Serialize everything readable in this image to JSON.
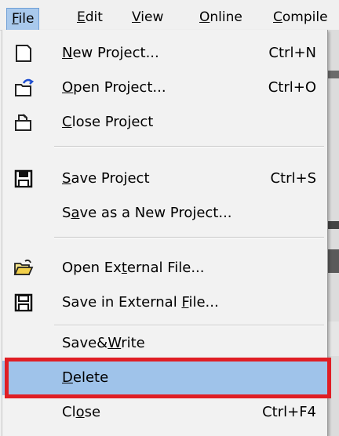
{
  "menubar": {
    "items": [
      {
        "label": "File",
        "u": "F"
      },
      {
        "label": "Edit",
        "u": "E"
      },
      {
        "label": "View",
        "u": "V"
      },
      {
        "label": "Online",
        "u": "O"
      },
      {
        "label": "Compile",
        "u": "C"
      }
    ]
  },
  "menu": {
    "items": [
      {
        "pre": "",
        "u": "N",
        "post": "ew Project...",
        "shortcut": "Ctrl+N",
        "icon": "new-project-icon"
      },
      {
        "pre": "",
        "u": "O",
        "post": "pen Project...",
        "shortcut": "Ctrl+O",
        "icon": "open-project-icon"
      },
      {
        "pre": "",
        "u": "C",
        "post": "lose Project",
        "shortcut": "",
        "icon": "close-project-icon"
      },
      {
        "pre": "",
        "u": "S",
        "post": "ave Project",
        "shortcut": "Ctrl+S",
        "icon": "save-project-icon"
      },
      {
        "pre": "S",
        "u": "a",
        "post": "ve as a New Project...",
        "shortcut": "",
        "icon": ""
      },
      {
        "pre": "Open Ex",
        "u": "t",
        "post": "ernal File...",
        "shortcut": "",
        "icon": "open-external-file-icon"
      },
      {
        "pre": "Save in External ",
        "u": "F",
        "post": "ile...",
        "shortcut": "",
        "icon": "save-external-file-icon"
      },
      {
        "pre": "Save&",
        "u": "W",
        "post": "rite",
        "shortcut": "",
        "icon": ""
      },
      {
        "pre": "",
        "u": "D",
        "post": "elete",
        "shortcut": "",
        "icon": ""
      },
      {
        "pre": "Cl",
        "u": "o",
        "post": "se",
        "shortcut": "Ctrl+F4",
        "icon": ""
      }
    ]
  },
  "colors": {
    "highlight": "#9fc3ea",
    "annotation_frame": "#e01e24",
    "menu_bg": "#f2f2f2",
    "active_menu": "#a9c9ec"
  }
}
